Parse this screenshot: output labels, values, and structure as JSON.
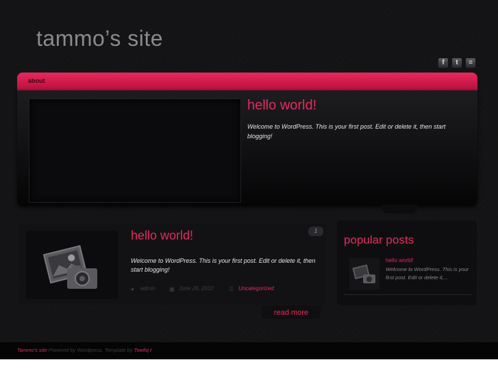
{
  "site": {
    "title": "tammo’s site"
  },
  "social": {
    "icons": [
      "facebook-icon",
      "twitter-icon",
      "rss-icon"
    ],
    "facebook_glyph": "f",
    "twitter_glyph": "t",
    "rss_glyph": "≡"
  },
  "nav": {
    "items": [
      {
        "label": "about"
      }
    ]
  },
  "featured": {
    "title": "hello world!",
    "excerpt": "Welcome to WordPress. This is your first post. Edit or delete it, then start blogging!"
  },
  "post": {
    "title": "hello world!",
    "comment_count": "1",
    "excerpt": "Welcome to WordPress. This is your first post. Edit or delete it, then start blogging!",
    "author": "admin",
    "date": "June 28, 2010",
    "category": "Uncategorized",
    "read_more": "read more"
  },
  "sidebar": {
    "title": "popular posts",
    "items": [
      {
        "title": "hello world!",
        "excerpt": "Welcome to WordPress. This is your first post. Edit or delete it,..."
      }
    ]
  },
  "footer": {
    "site_link": "Tammo's site",
    "powered_text": " Powered by Wordpress. Template by ",
    "author_link": "Towfiq I"
  },
  "colors": {
    "accent": "#e8285e",
    "background": "#141416",
    "nav_dark": "#b80f3c"
  }
}
